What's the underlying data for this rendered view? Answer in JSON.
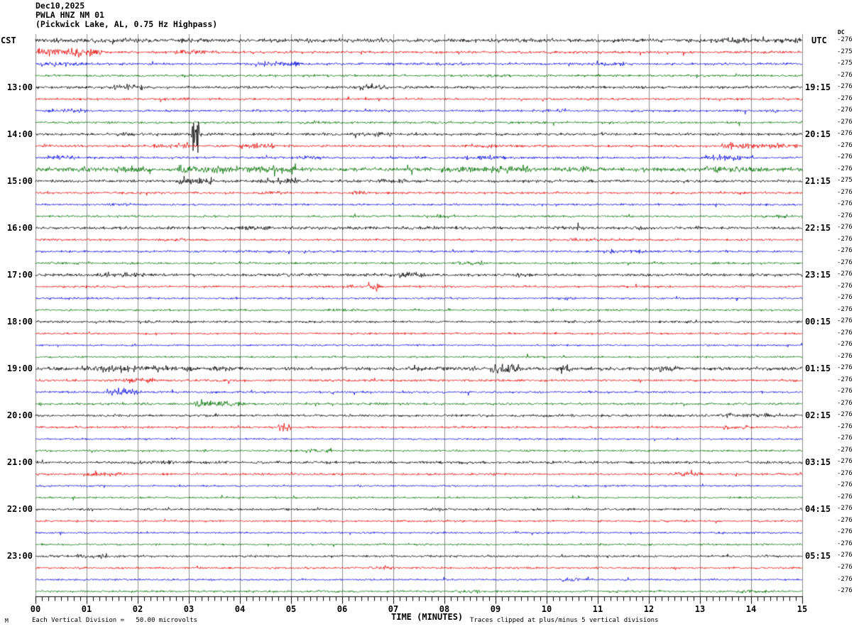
{
  "title": {
    "date": "Dec10,2025",
    "station": "PWLA HNZ NM 01",
    "subtitle": "(Pickwick Lake, AL, 0.75 Hz Highpass)"
  },
  "axes": {
    "left_header": "CST",
    "right_header": "UTC",
    "dc_header": "DC",
    "x_label": "TIME (MINUTES)",
    "x_ticks": [
      "00",
      "01",
      "02",
      "03",
      "04",
      "05",
      "06",
      "07",
      "08",
      "09",
      "10",
      "11",
      "12",
      "13",
      "14",
      "15"
    ],
    "footer_left": "Each Vertical Division =   50.00 microvolts",
    "footer_right": "Traces clipped at plus/minus 5 vertical divisions",
    "watermark": "M"
  },
  "chart_data": {
    "type": "line",
    "description": "Helicorder seismogram, 48 trace lines of 15 minutes each, colors cycle black/red/blue/green",
    "x_range_minutes": [
      0,
      15
    ],
    "minutes_per_line": 15,
    "vertical_division_microvolts": 50.0,
    "clip_divisions": 5,
    "grid_color": "#8c8c8c",
    "trace_colors": {
      "black": "#000000",
      "red": "#e60000",
      "blue": "#0000e0",
      "green": "#006e00"
    },
    "rows": [
      {
        "color": "black",
        "cst": null,
        "utc": null,
        "dc": "-276",
        "base_amp": 2.2,
        "bursts": [
          [
            0,
            1.2,
            3
          ],
          [
            5.3,
            6.2,
            2.6
          ],
          [
            11.3,
            12.1,
            2.6
          ],
          [
            13.2,
            14.1,
            3.4
          ],
          [
            14.5,
            15,
            2.8
          ]
        ]
      },
      {
        "color": "red",
        "cst": null,
        "utc": null,
        "dc": "-275",
        "base_amp": 1.5,
        "bursts": [
          [
            0.05,
            1.3,
            5
          ],
          [
            2.7,
            3.4,
            2.6
          ]
        ]
      },
      {
        "color": "blue",
        "cst": null,
        "utc": null,
        "dc": "-275",
        "base_amp": 1.4,
        "bursts": [
          [
            0.1,
            0.9,
            2.6
          ],
          [
            4.3,
            5.2,
            3
          ],
          [
            7.8,
            8.4,
            2
          ],
          [
            10.8,
            11.5,
            2.2
          ]
        ]
      },
      {
        "color": "green",
        "cst": null,
        "utc": null,
        "dc": "-276",
        "base_amp": 1.3,
        "bursts": [
          [
            8.7,
            9.3,
            2.2
          ]
        ]
      },
      {
        "color": "black",
        "cst": "13:00",
        "utc": "19:15",
        "dc": "-276",
        "base_amp": 1.6,
        "bursts": [
          [
            1.5,
            2.1,
            3
          ],
          [
            6.2,
            6.9,
            3
          ]
        ]
      },
      {
        "color": "red",
        "cst": null,
        "utc": null,
        "dc": "-276",
        "base_amp": 1.3,
        "bursts": [
          [
            2.5,
            3.0,
            2
          ]
        ]
      },
      {
        "color": "blue",
        "cst": null,
        "utc": null,
        "dc": "-276",
        "base_amp": 1.3,
        "bursts": [
          [
            0.2,
            0.9,
            2.8
          ],
          [
            9.9,
            10.4,
            2
          ]
        ]
      },
      {
        "color": "green",
        "cst": null,
        "utc": null,
        "dc": "-276",
        "base_amp": 1.3,
        "bursts": [
          [
            5.2,
            5.7,
            2.2
          ]
        ]
      },
      {
        "color": "black",
        "cst": "14:00",
        "utc": "20:15",
        "dc": "-276",
        "base_amp": 1.6,
        "bursts": [
          [
            1.4,
            1.9,
            2.4
          ],
          [
            3.05,
            3.2,
            24
          ],
          [
            6.4,
            7.0,
            2.6
          ]
        ]
      },
      {
        "color": "red",
        "cst": null,
        "utc": null,
        "dc": "-276",
        "base_amp": 1.4,
        "bursts": [
          [
            2.3,
            3.0,
            3
          ],
          [
            4.0,
            4.7,
            3
          ],
          [
            8.5,
            9.1,
            2.4
          ],
          [
            13.4,
            14.9,
            3.4
          ]
        ]
      },
      {
        "color": "blue",
        "cst": null,
        "utc": null,
        "dc": "-276",
        "base_amp": 1.4,
        "bursts": [
          [
            0.3,
            0.8,
            3
          ],
          [
            5.1,
            5.6,
            2.2
          ],
          [
            8.4,
            9.2,
            3.2
          ],
          [
            13.1,
            13.8,
            3.4
          ]
        ]
      },
      {
        "color": "green",
        "cst": null,
        "utc": null,
        "dc": "-276",
        "base_amp": 2.2,
        "bursts": [
          [
            0.4,
            1.1,
            3.6
          ],
          [
            1.6,
            2.3,
            4.5
          ],
          [
            2.8,
            5.1,
            4.2
          ],
          [
            7.9,
            9.7,
            3.6
          ],
          [
            10.3,
            11.1,
            3.2
          ],
          [
            13.1,
            14.2,
            3.4
          ]
        ]
      },
      {
        "color": "black",
        "cst": "15:00",
        "utc": "21:15",
        "dc": "-275",
        "base_amp": 1.6,
        "bursts": [
          [
            2.8,
            3.5,
            5
          ],
          [
            4.4,
            5.2,
            3.4
          ],
          [
            6.7,
            7.3,
            2.4
          ]
        ]
      },
      {
        "color": "red",
        "cst": null,
        "utc": null,
        "dc": "-276",
        "base_amp": 1.3,
        "bursts": [
          [
            4.4,
            4.9,
            2.6
          ],
          [
            6.2,
            6.7,
            2
          ]
        ]
      },
      {
        "color": "blue",
        "cst": null,
        "utc": null,
        "dc": "-276",
        "base_amp": 1.2,
        "bursts": [
          [
            1.4,
            1.9,
            2
          ]
        ]
      },
      {
        "color": "green",
        "cst": null,
        "utc": null,
        "dc": "-276",
        "base_amp": 1.2,
        "bursts": [
          [
            7.6,
            8.2,
            2.4
          ],
          [
            14.2,
            14.7,
            2
          ]
        ]
      },
      {
        "color": "black",
        "cst": "16:00",
        "utc": "22:15",
        "dc": "-276",
        "base_amp": 1.8,
        "bursts": [
          [
            3.7,
            4.5,
            2.4
          ],
          [
            10.1,
            10.7,
            2.4
          ]
        ]
      },
      {
        "color": "red",
        "cst": null,
        "utc": null,
        "dc": "-276",
        "base_amp": 1.3,
        "bursts": [
          [
            2.4,
            3.0,
            2
          ],
          [
            10.4,
            11.1,
            2.4
          ]
        ]
      },
      {
        "color": "blue",
        "cst": null,
        "utc": null,
        "dc": "-276",
        "base_amp": 1.3,
        "bursts": [
          [
            4.1,
            4.7,
            2
          ],
          [
            11.1,
            11.9,
            2.4
          ]
        ]
      },
      {
        "color": "green",
        "cst": null,
        "utc": null,
        "dc": "-276",
        "base_amp": 1.3,
        "bursts": [
          [
            8.2,
            8.8,
            2.4
          ]
        ]
      },
      {
        "color": "black",
        "cst": "17:00",
        "utc": "23:15",
        "dc": "-276",
        "base_amp": 1.6,
        "bursts": [
          [
            1.2,
            2.2,
            3
          ],
          [
            4.8,
            5.3,
            2.4
          ],
          [
            7.1,
            7.6,
            3.4
          ],
          [
            9.2,
            9.7,
            2.4
          ]
        ]
      },
      {
        "color": "red",
        "cst": null,
        "utc": null,
        "dc": "-276",
        "base_amp": 1.3,
        "bursts": [
          [
            5.7,
            6.2,
            2
          ],
          [
            6.5,
            6.75,
            5.5
          ]
        ]
      },
      {
        "color": "blue",
        "cst": null,
        "utc": null,
        "dc": "-276",
        "base_amp": 1.2,
        "bursts": [
          [
            10.1,
            10.6,
            2
          ]
        ]
      },
      {
        "color": "green",
        "cst": null,
        "utc": null,
        "dc": "-276",
        "base_amp": 1.2,
        "bursts": [
          [
            5.8,
            6.3,
            2
          ]
        ]
      },
      {
        "color": "black",
        "cst": "18:00",
        "utc": "00:15",
        "dc": "-276",
        "base_amp": 1.4,
        "bursts": []
      },
      {
        "color": "red",
        "cst": null,
        "utc": null,
        "dc": "-276",
        "base_amp": 1.2,
        "bursts": []
      },
      {
        "color": "blue",
        "cst": null,
        "utc": null,
        "dc": "-276",
        "base_amp": 1.1,
        "bursts": []
      },
      {
        "color": "green",
        "cst": null,
        "utc": null,
        "dc": "-276",
        "base_amp": 1.1,
        "bursts": []
      },
      {
        "color": "black",
        "cst": "19:00",
        "utc": "01:15",
        "dc": "-276",
        "base_amp": 2.0,
        "bursts": [
          [
            0.9,
            2.4,
            3.6
          ],
          [
            2.5,
            3.1,
            3
          ],
          [
            3.5,
            4.0,
            3
          ],
          [
            5.9,
            6.4,
            2.2
          ],
          [
            8.9,
            9.5,
            5
          ],
          [
            10.2,
            10.5,
            4.5
          ],
          [
            11.9,
            12.6,
            3
          ]
        ]
      },
      {
        "color": "red",
        "cst": null,
        "utc": null,
        "dc": "-276",
        "base_amp": 1.4,
        "bursts": [
          [
            1.7,
            2.3,
            3
          ]
        ]
      },
      {
        "color": "blue",
        "cst": null,
        "utc": null,
        "dc": "-276",
        "base_amp": 1.3,
        "bursts": [
          [
            1.4,
            2.1,
            3.4
          ]
        ]
      },
      {
        "color": "green",
        "cst": null,
        "utc": null,
        "dc": "-276",
        "base_amp": 1.3,
        "bursts": [
          [
            3.1,
            4.1,
            3.4
          ]
        ]
      },
      {
        "color": "black",
        "cst": "20:00",
        "utc": "02:15",
        "dc": "-276",
        "base_amp": 1.5,
        "bursts": [
          [
            13.4,
            14.6,
            2.6
          ]
        ]
      },
      {
        "color": "red",
        "cst": null,
        "utc": null,
        "dc": "-276",
        "base_amp": 1.3,
        "bursts": [
          [
            4.75,
            5.0,
            4.5
          ],
          [
            13.4,
            13.95,
            3
          ]
        ]
      },
      {
        "color": "blue",
        "cst": null,
        "utc": null,
        "dc": "-276",
        "base_amp": 1.1,
        "bursts": []
      },
      {
        "color": "green",
        "cst": null,
        "utc": null,
        "dc": "-276",
        "base_amp": 1.2,
        "bursts": [
          [
            5.2,
            5.8,
            2
          ]
        ]
      },
      {
        "color": "black",
        "cst": "21:00",
        "utc": "03:15",
        "dc": "-276",
        "base_amp": 1.5,
        "bursts": [
          [
            1.9,
            2.7,
            2.2
          ]
        ]
      },
      {
        "color": "red",
        "cst": null,
        "utc": null,
        "dc": "-276",
        "base_amp": 1.3,
        "bursts": [
          [
            0.9,
            1.7,
            3
          ],
          [
            12.5,
            13.1,
            2.6
          ]
        ]
      },
      {
        "color": "blue",
        "cst": null,
        "utc": null,
        "dc": "-276",
        "base_amp": 1.1,
        "bursts": []
      },
      {
        "color": "green",
        "cst": null,
        "utc": null,
        "dc": "-276",
        "base_amp": 1.1,
        "bursts": []
      },
      {
        "color": "black",
        "cst": "22:00",
        "utc": "04:15",
        "dc": "-276",
        "base_amp": 1.3,
        "bursts": [
          [
            7.5,
            8.0,
            2
          ]
        ]
      },
      {
        "color": "red",
        "cst": null,
        "utc": null,
        "dc": "-276",
        "base_amp": 1.2,
        "bursts": []
      },
      {
        "color": "blue",
        "cst": null,
        "utc": null,
        "dc": "-276",
        "base_amp": 1.1,
        "bursts": []
      },
      {
        "color": "green",
        "cst": null,
        "utc": null,
        "dc": "-276",
        "base_amp": 1.1,
        "bursts": []
      },
      {
        "color": "black",
        "cst": "23:00",
        "utc": "05:15",
        "dc": "-276",
        "base_amp": 1.3,
        "bursts": [
          [
            0.8,
            1.4,
            2.6
          ]
        ]
      },
      {
        "color": "red",
        "cst": null,
        "utc": null,
        "dc": "-276",
        "base_amp": 1.2,
        "bursts": [
          [
            6.5,
            7.0,
            2.2
          ]
        ]
      },
      {
        "color": "blue",
        "cst": null,
        "utc": null,
        "dc": "-276",
        "base_amp": 1.1,
        "bursts": [
          [
            10.3,
            10.9,
            2
          ]
        ]
      },
      {
        "color": "green",
        "cst": null,
        "utc": null,
        "dc": "-276",
        "base_amp": 1.2,
        "bursts": [
          [
            8.2,
            8.7,
            2
          ],
          [
            13.7,
            14.3,
            2.2
          ]
        ]
      }
    ]
  }
}
